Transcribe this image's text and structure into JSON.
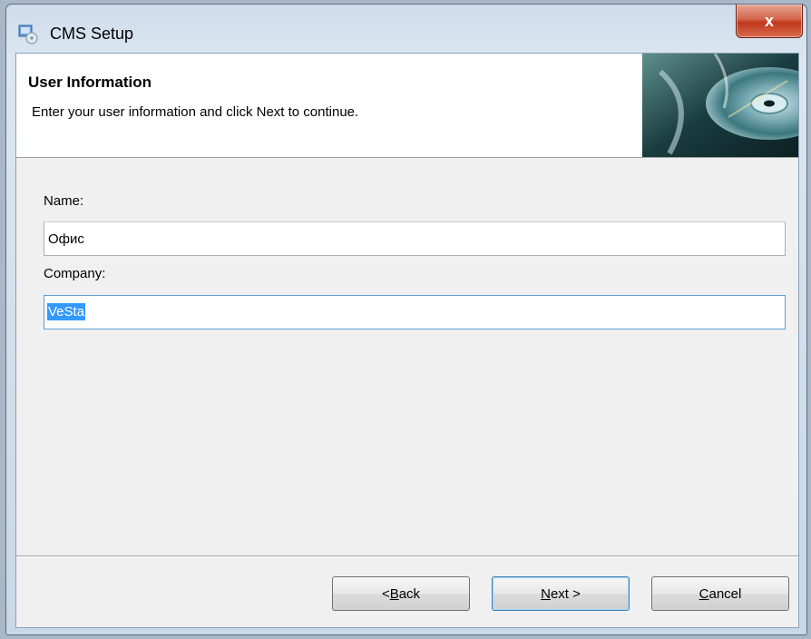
{
  "window": {
    "title": "CMS Setup",
    "close_label": "x"
  },
  "header": {
    "title": "User Information",
    "subtitle": "Enter your user information and click Next to continue."
  },
  "form": {
    "name_label": "Name:",
    "name_value": "Офис",
    "company_label": "Company:",
    "company_value": "VeSta"
  },
  "buttons": {
    "back_accel": "B",
    "back_rest": "ack",
    "back_prefix": "< ",
    "next_accel": "N",
    "next_rest": "ext >",
    "cancel_accel": "C",
    "cancel_rest": "ancel"
  }
}
